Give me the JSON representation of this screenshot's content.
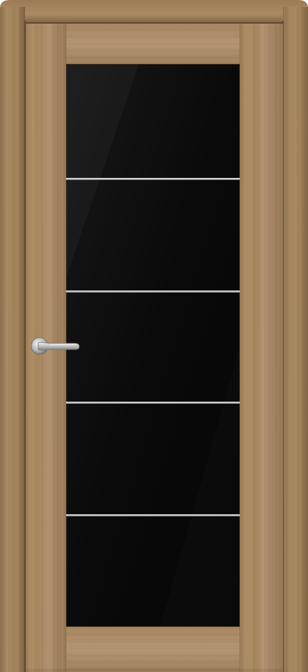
{
  "product": {
    "subject": "interior-door",
    "wood_finish": "light-oak",
    "glass_tint": "black",
    "glass_panels": 5,
    "strip_accent": "silver",
    "handle": "lever-handle-chrome"
  },
  "colors": {
    "wood_base": "#a7875f",
    "wood_light": "#b8976c",
    "wood_dark": "#8a6c48",
    "frame_edge": "#6f5537",
    "glass": "#0b0b0b",
    "strip": "#cfcfcf",
    "handle": "#bdbdbd",
    "background": "#ffffff"
  }
}
